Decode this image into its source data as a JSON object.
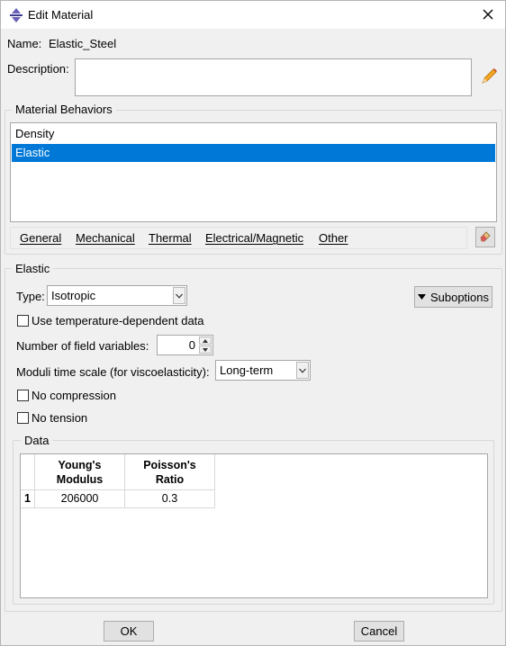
{
  "window": {
    "title": "Edit Material"
  },
  "name": {
    "label": "Name:",
    "value": "Elastic_Steel"
  },
  "description": {
    "label": "Description:",
    "value": ""
  },
  "material_behaviors": {
    "title": "Material Behaviors",
    "items": [
      {
        "label": "Density",
        "selected": false
      },
      {
        "label": "Elastic",
        "selected": true
      }
    ],
    "menu": [
      "General",
      "Mechanical",
      "Thermal",
      "Electrical/Magnetic",
      "Other"
    ]
  },
  "elastic": {
    "title": "Elastic",
    "type_label": "Type:",
    "type_value": "Isotropic",
    "suboptions_label": "Suboptions",
    "temp_dependent_label": "Use temperature-dependent data",
    "temp_dependent_checked": false,
    "field_vars_label": "Number of field variables:",
    "field_vars_value": "0",
    "moduli_label": "Moduli time scale (for viscoelasticity):",
    "moduli_value": "Long-term",
    "no_compression_label": "No compression",
    "no_compression_checked": false,
    "no_tension_label": "No tension",
    "no_tension_checked": false
  },
  "data_table": {
    "title": "Data",
    "columns": [
      {
        "line1": "Young's",
        "line2": "Modulus"
      },
      {
        "line1": "Poisson's",
        "line2": "Ratio"
      }
    ],
    "rows": [
      {
        "index": "1",
        "cells": [
          "206000",
          "0.3"
        ]
      }
    ]
  },
  "footer": {
    "ok_label": "OK",
    "cancel_label": "Cancel"
  },
  "colors": {
    "selection": "#0078d7",
    "background": "#f0f0f0"
  },
  "icons": [
    "app-icon",
    "close-icon",
    "pencil-icon",
    "eraser-icon",
    "dropdown-arrow-icon",
    "triangle-down-icon",
    "spin-up-icon",
    "spin-down-icon"
  ]
}
